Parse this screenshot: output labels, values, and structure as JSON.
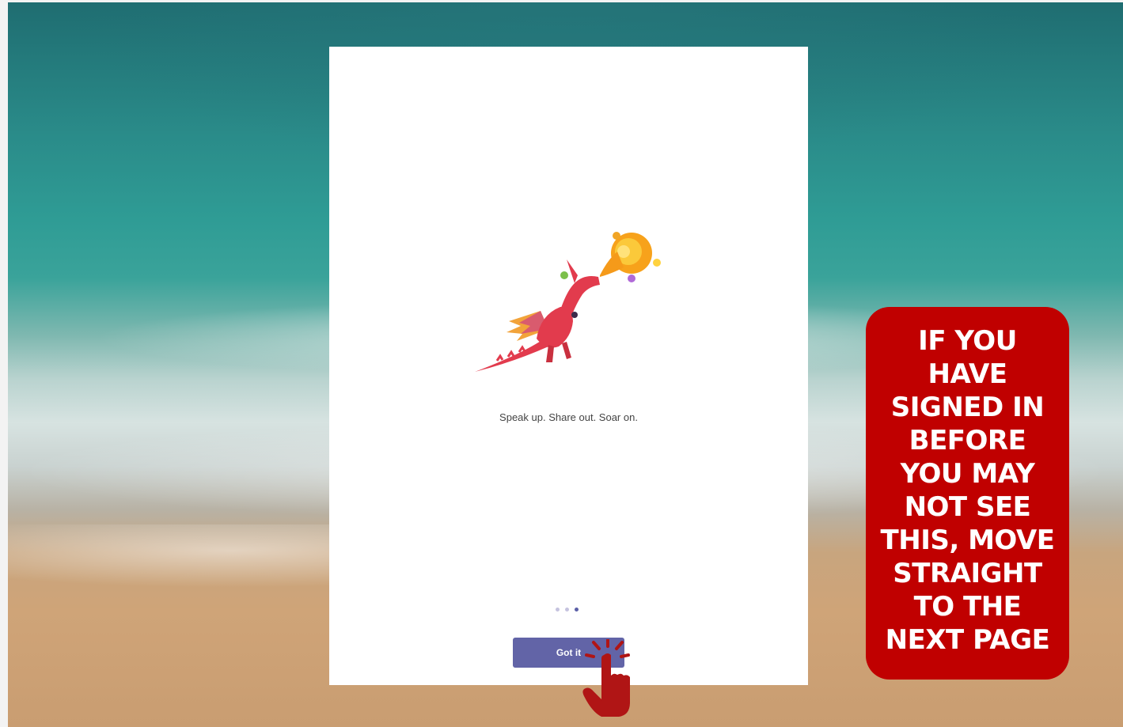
{
  "onboarding": {
    "tagline": "Speak up. Share out. Soar on.",
    "page_indicator": {
      "total": 3,
      "active": 3
    },
    "got_it_label": "Got it",
    "illustration": "dragon-illustration"
  },
  "callout": {
    "lines": [
      "IF YOU",
      "HAVE",
      "SIGNED IN",
      "BEFORE",
      "YOU MAY",
      "NOT SEE",
      "THIS, MOVE",
      "STRAIGHT",
      "TO THE",
      "NEXT PAGE"
    ],
    "color": "#c00000"
  },
  "pointer": {
    "icon": "pointing-hand-icon",
    "color": "#b01515"
  },
  "accent": "#6264a7"
}
